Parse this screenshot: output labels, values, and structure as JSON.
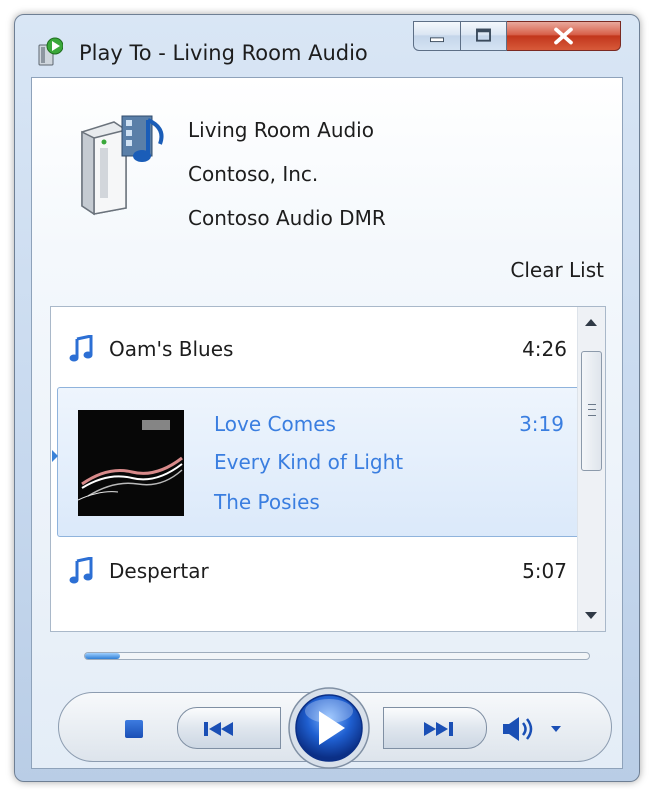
{
  "window": {
    "title": "Play To - Living Room Audio"
  },
  "device": {
    "name": "Living Room Audio",
    "manufacturer": "Contoso, Inc.",
    "model": "Contoso Audio DMR"
  },
  "actions": {
    "clear_list": "Clear List"
  },
  "playlist": [
    {
      "title": "Oam's Blues",
      "duration": "4:26"
    },
    {
      "title": "Love Comes",
      "album": "Every Kind of Light",
      "artist": "The Posies",
      "duration": "3:19",
      "selected": true
    },
    {
      "title": "Despertar",
      "duration": "5:07"
    }
  ],
  "playback": {
    "progress_fraction": 0.07
  },
  "colors": {
    "accent": "#3a7ee0",
    "close_button": "#c2361c"
  },
  "icons": [
    "play-to-icon",
    "minimize-icon",
    "maximize-icon",
    "close-icon",
    "media-device-icon",
    "music-note-icon",
    "album-art",
    "stop-icon",
    "previous-icon",
    "play-icon",
    "next-icon",
    "volume-icon",
    "chevron-down-icon"
  ]
}
